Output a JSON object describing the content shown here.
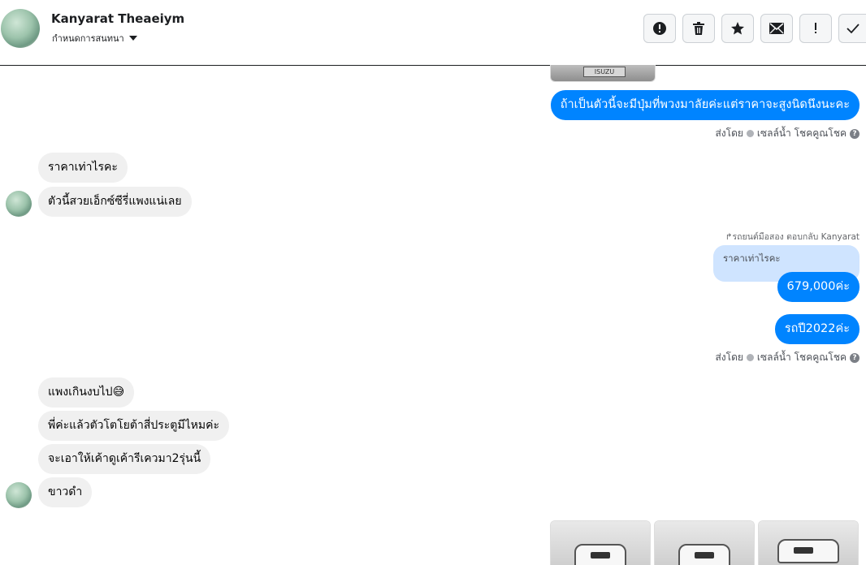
{
  "header": {
    "name": "Kanyarat Theaeiym",
    "subtitle": "กำหนดการสนทนา",
    "tools": [
      {
        "name": "spam-button",
        "icon": "alert-circle-icon"
      },
      {
        "name": "delete-button",
        "icon": "trash-icon"
      },
      {
        "name": "star-button",
        "icon": "star-icon"
      },
      {
        "name": "mark-unread-button",
        "icon": "mail-icon"
      },
      {
        "name": "follow-up-button",
        "icon": "exclamation-icon"
      },
      {
        "name": "done-button",
        "icon": "check-icon"
      }
    ]
  },
  "messages": {
    "out1": "ถ้าเป็นตัวนี้จะมีปุ่มที่พวงมาลัยค่ะแต่ราคาจะสูงนิดนึงนะคะ",
    "in1": "ราคาเท่าไรคะ",
    "in2": "ตัวนี้สวยเอ็กซ์ซีรี่แพงแน่เลย",
    "reply_header": "รถยนต์มือสอง ตอบกลับ Kanyarat",
    "quoted": "ราคาเท่าไรคะ",
    "out2": "679,000ค่ะ",
    "out3": "รถปี2022ค่ะ",
    "in3": "แพงเกินงบไป😅",
    "in4": "พี่ค่ะแล้วตัวโตโยต้าสี่ประตูมีไหมค่ะ",
    "in5": "จะเอาให้เค้าดูเค้ารีเควมา2รุ่นนี้",
    "in6": "ขาวดำ"
  },
  "meta": {
    "sent_by": "ส่งโดย",
    "sender": "เซลล์น้ำ โชคคูณโชค",
    "help": "?"
  },
  "images": {
    "top_plate": "ISUZU"
  },
  "colors": {
    "outgoing": "#0084ff",
    "incoming": "#f0f0f0",
    "quoted": "#cfe4ff"
  }
}
